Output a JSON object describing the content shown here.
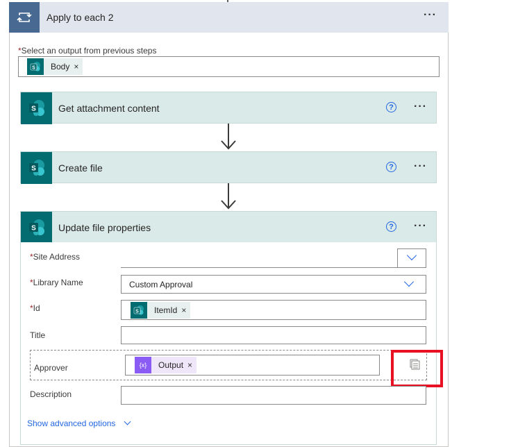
{
  "outer": {
    "title": "Apply to each 2",
    "menu": "···",
    "select_label": "Select an output from previous steps",
    "required_mark": "*",
    "token": {
      "label": "Body",
      "remove": "×",
      "icon": "sharepoint-icon"
    }
  },
  "actions": [
    {
      "title": "Get attachment content",
      "help": "?",
      "menu": "···",
      "icon": "sharepoint-icon"
    },
    {
      "title": "Create file",
      "help": "?",
      "menu": "···",
      "icon": "sharepoint-icon"
    },
    {
      "title": "Update file properties",
      "help": "?",
      "menu": "···",
      "icon": "sharepoint-icon"
    }
  ],
  "form": {
    "site_address": {
      "label": "Site Address",
      "required": "*",
      "value": ""
    },
    "library_name": {
      "label": "Library Name",
      "required": "*",
      "value": "Custom Approval"
    },
    "id": {
      "label": "Id",
      "required": "*",
      "token": {
        "label": "ItemId",
        "remove": "×",
        "icon": "sharepoint-icon"
      }
    },
    "title": {
      "label": "Title",
      "value": ""
    },
    "approver": {
      "label": "Approver",
      "token": {
        "label": "Output",
        "remove": "×",
        "icon": "variable-icon",
        "glyph": "{x}"
      }
    },
    "description": {
      "label": "Description",
      "value": ""
    },
    "advanced_link": "Show advanced options"
  },
  "colors": {
    "loop_header": "#486991",
    "sharepoint": "#036c70",
    "action_header": "#daeae8",
    "link": "#2266e3",
    "variable": "#770bd6",
    "highlight": "#e81123"
  }
}
